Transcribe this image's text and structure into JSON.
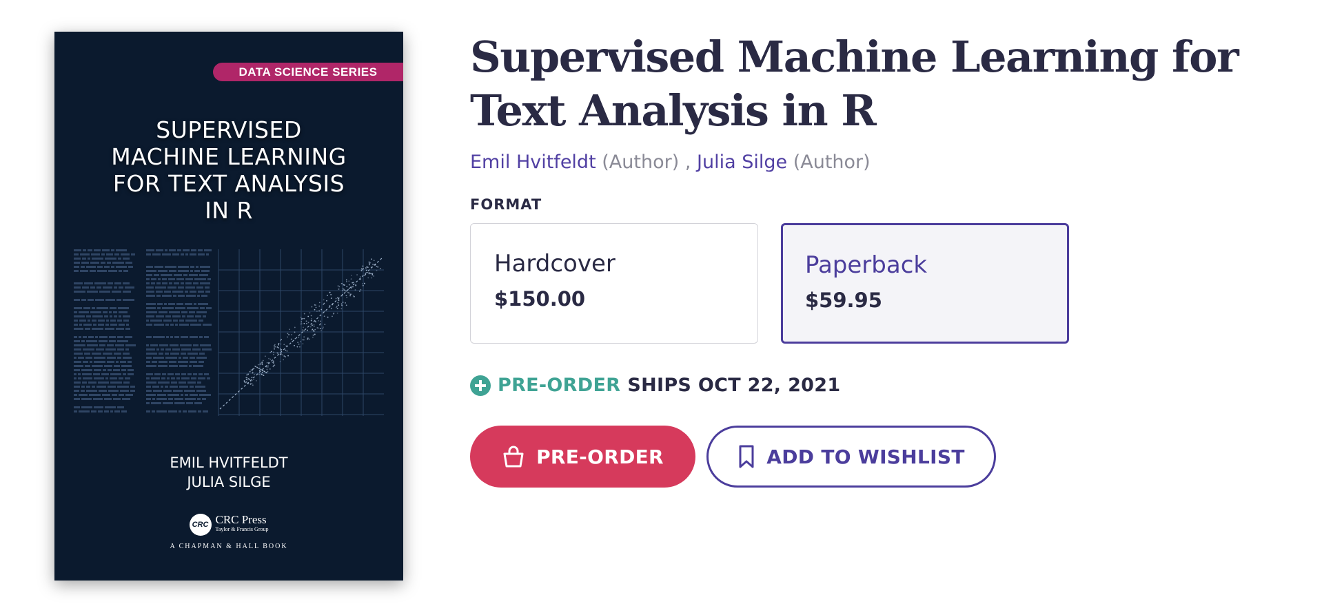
{
  "cover": {
    "series_banner": "DATA SCIENCE SERIES",
    "title_lines": [
      "SUPERVISED",
      "MACHINE LEARNING",
      "FOR TEXT ANALYSIS",
      "IN R"
    ],
    "author_lines": [
      "EMIL HVITFELDT",
      "JULIA SILGE"
    ],
    "publisher_logo": "CRC",
    "publisher_name": "CRC Press",
    "publisher_sub": "Taylor & Francis Group",
    "publisher_line": "A CHAPMAN & HALL BOOK"
  },
  "product": {
    "title": "Supervised Machine Learning for Text Analysis in R",
    "authors": [
      {
        "name": "Emil Hvitfeldt",
        "role": "(Author)"
      },
      {
        "name": "Julia Silge",
        "role": "(Author)"
      }
    ],
    "author_separator": ","
  },
  "format": {
    "label": "FORMAT",
    "options": [
      {
        "name": "Hardcover",
        "price": "$150.00",
        "selected": false
      },
      {
        "name": "Paperback",
        "price": "$59.95",
        "selected": true
      }
    ]
  },
  "shipping": {
    "icon": "plus-circle-icon",
    "status": "PRE-ORDER",
    "text": "SHIPS OCT 22, 2021"
  },
  "actions": {
    "preorder_label": "PRE-ORDER",
    "preorder_icon": "shopping-bag-icon",
    "wishlist_label": "ADD TO WISHLIST",
    "wishlist_icon": "bookmark-icon"
  },
  "colors": {
    "accent": "#4b3d9c",
    "preorder_button": "#d63a5c",
    "preorder_status": "#3fa394",
    "cover_background": "#0b1a2e",
    "series_banner": "#b02668"
  }
}
